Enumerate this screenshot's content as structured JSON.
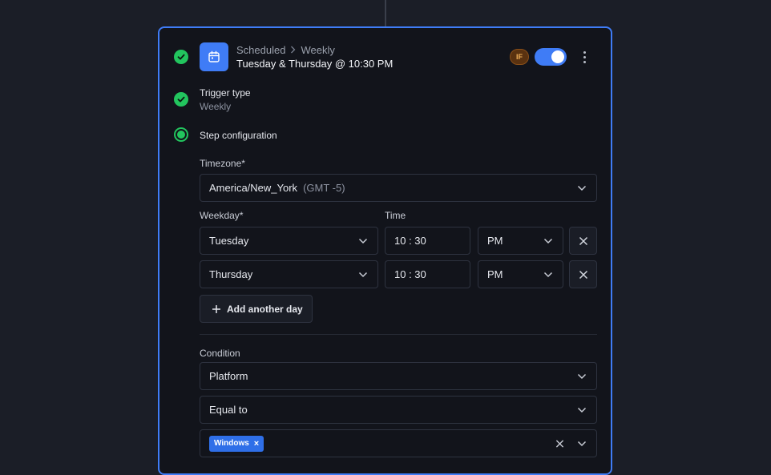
{
  "header": {
    "breadcrumb": [
      "Scheduled",
      "Weekly"
    ],
    "title": "Tuesday & Thursday @ 10:30 PM",
    "badge": "IF",
    "enabled": true,
    "icon": "calendar-icon"
  },
  "trigger": {
    "label": "Trigger type",
    "value": "Weekly"
  },
  "step": {
    "label": "Step configuration"
  },
  "timezone": {
    "label": "Timezone",
    "required_mark": "*",
    "value": "America/New_York",
    "offset": "(GMT -5)"
  },
  "schedule": {
    "weekday_label": "Weekday",
    "required_mark": "*",
    "time_label": "Time",
    "rows": [
      {
        "day": "Tuesday",
        "time": "10 : 30",
        "period": "PM"
      },
      {
        "day": "Thursday",
        "time": "10 : 30",
        "period": "PM"
      }
    ],
    "add_label": "Add another day"
  },
  "condition": {
    "label": "Condition",
    "field": "Platform",
    "operator": "Equal to",
    "values": [
      "Windows"
    ],
    "chip_remove": "×"
  },
  "colors": {
    "accent": "#3f7cf6",
    "success": "#22c55e",
    "badge": "#5a3210"
  }
}
